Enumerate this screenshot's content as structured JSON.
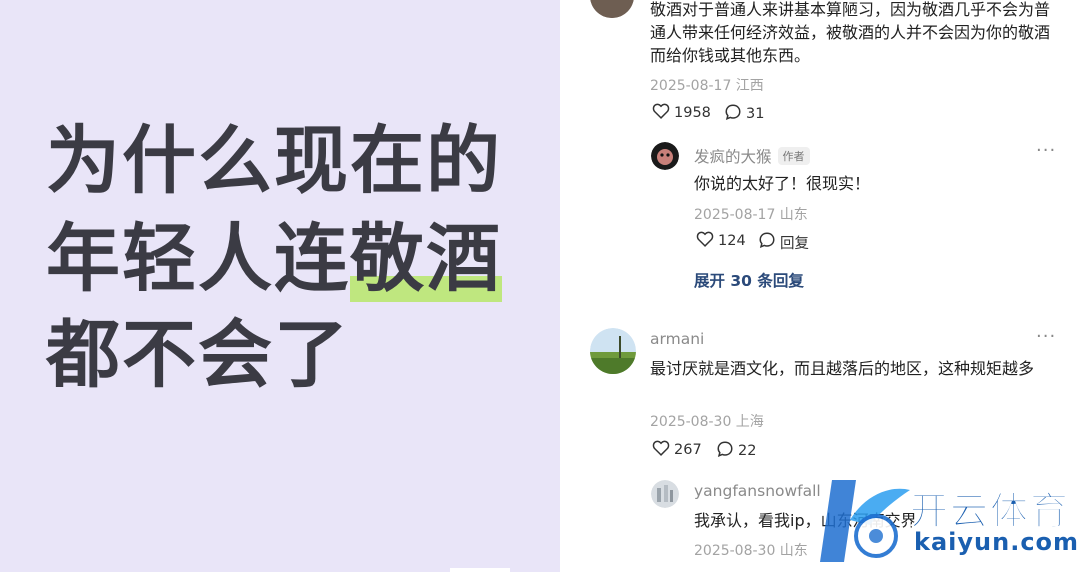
{
  "poster": {
    "line1": "为什么现在的",
    "line2_plain": "年轻人连",
    "line2_highlight": "敬酒",
    "line3": "都不会了",
    "highlight_color": "#bfe77f",
    "background_color": "#e9e5f8"
  },
  "comments": [
    {
      "text": "敬酒对于普通人来讲基本算陋习，因为敬酒几乎不会为普通人带来任何经济效益，被敬酒的人并不会因为你的敬酒而给你钱或其他东西。",
      "date": "2025-08-17 江西",
      "likes": "1958",
      "replies": "31",
      "reply": {
        "author": "发疯的大猴",
        "badge": "作者",
        "text": "你说的太好了！很现实！",
        "date": "2025-08-17 山东",
        "likes": "124",
        "reply_label": "回复"
      },
      "expand_label": "展开 30 条回复"
    },
    {
      "author": "armani",
      "text": "最讨厌就是酒文化，而且越落后的地区，这种规矩越多",
      "date": "2025-08-30 上海",
      "likes": "267",
      "replies": "22",
      "reply": {
        "author": "yangfansnowfall",
        "text": "我承认，看我ip，山东河南交界",
        "date": "2025-08-30 山东"
      }
    }
  ],
  "icons": {
    "like": "heart-outline-icon",
    "comment": "speech-bubble-icon",
    "more": "more-dots-icon"
  },
  "watermark": {
    "cn": "开云体育",
    "en": "kaiyun.com"
  }
}
